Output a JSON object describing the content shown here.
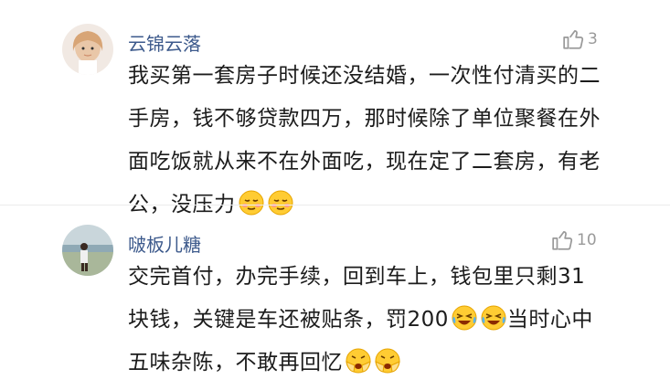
{
  "comments": [
    {
      "username": "云锦云落",
      "likes": "3",
      "avatar_icon": "girl-avatar",
      "lines": [
        "我买第一套房子时候还没结婚，一次性付清买的二",
        "手房，钱不够贷款四万，那时候除了单位聚餐在外",
        "面吃饭就从来不在外面吃，现在定了二套房，有老",
        "公，没压力"
      ],
      "emojis": [
        "smirk-face-icon",
        "smirk-face-icon"
      ]
    },
    {
      "username": "啵板儿糖",
      "likes": "10",
      "avatar_icon": "beach-person-avatar",
      "lines": [
        "交完首付，办完手续，回到车上，钱包里只剩31",
        "块钱，关键是车还被贴条，罚200",
        "五味杂陈，不敢再回忆"
      ],
      "line2_suffix": "当时心中",
      "emojis_mid": [
        "laugh-cry-face-icon",
        "laugh-cry-face-icon"
      ],
      "emojis_end": [
        "crying-hands-face-icon",
        "crying-hands-face-icon"
      ]
    }
  ],
  "colors": {
    "username": "#3d5a8c",
    "text": "#1c1c1c",
    "like": "#9a9a9a"
  }
}
